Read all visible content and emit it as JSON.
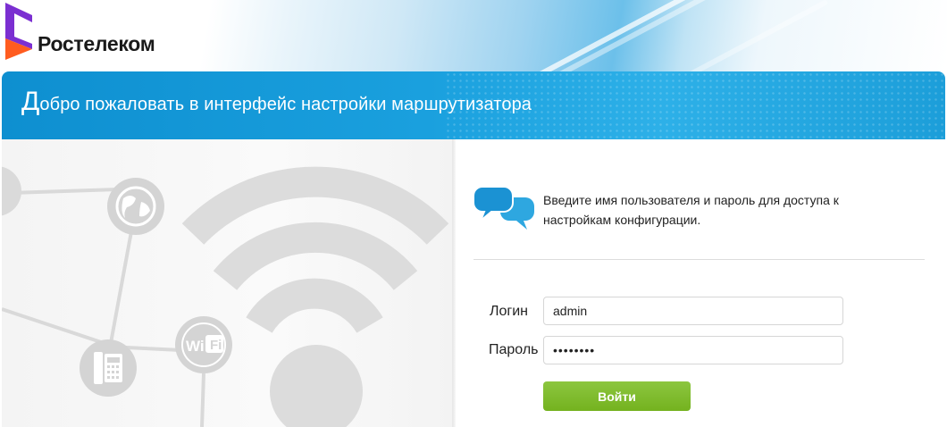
{
  "brand": {
    "logo_text": "Ростелеком",
    "logo_icon": "rostelecom-logo-icon"
  },
  "banner": {
    "title_first_letter": "Д",
    "title_rest": "обро пожаловать в интерфейс настройки маршрутизатора"
  },
  "illustration": {
    "icons": [
      "globe-icon",
      "wifi-label-icon",
      "phone-icon",
      "wifi-signal-icon"
    ],
    "wifi_badge_text": "WiFi"
  },
  "login_form": {
    "intro_icon": "chat-bubbles-icon",
    "intro_text": "Введите имя пользователя и пароль для доступа к настройкам конфигурации.",
    "login_label": "Логин",
    "login_value": "admin",
    "password_label": "Пароль",
    "password_value": "••••••••",
    "submit_label": "Войти"
  },
  "colors": {
    "banner_blue": "#1aa0de",
    "button_green": "#7ab82a",
    "logo_purple": "#7b2fd1",
    "logo_orange": "#ff5c1f"
  }
}
